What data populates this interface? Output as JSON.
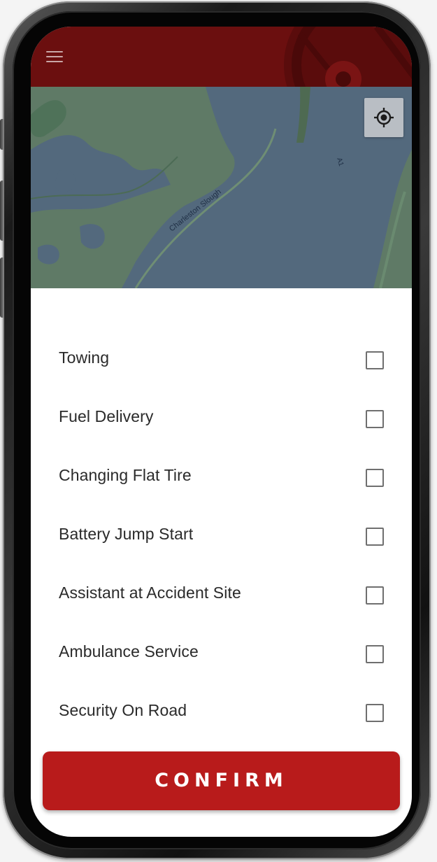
{
  "header": {
    "menu_icon": "hamburger-menu-icon",
    "background_color": "#6b0f0f",
    "emblem_icon": "steering-wheel-icon"
  },
  "map": {
    "water_label": "Charleston Slough",
    "road_label": "A1",
    "locate_icon": "my-location-icon"
  },
  "services": [
    {
      "label": "Towing",
      "checked": false
    },
    {
      "label": "Fuel Delivery",
      "checked": false
    },
    {
      "label": "Changing Flat Tire",
      "checked": false
    },
    {
      "label": "Battery Jump Start",
      "checked": false
    },
    {
      "label": "Assistant at Accident Site",
      "checked": false
    },
    {
      "label": "Ambulance Service",
      "checked": false
    },
    {
      "label": "Security On Road",
      "checked": false
    }
  ],
  "confirm": {
    "label": "CONFIRM",
    "color": "#b81b1b"
  }
}
